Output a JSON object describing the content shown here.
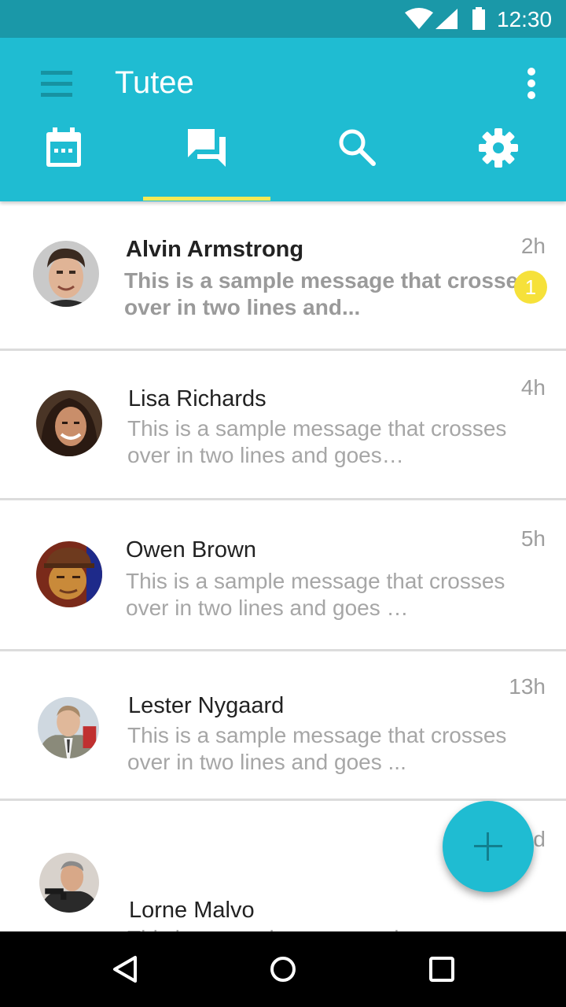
{
  "status_bar": {
    "time": "12:30",
    "icons": [
      "wifi-icon",
      "signal-icon",
      "battery-icon"
    ]
  },
  "app_bar": {
    "title": "Tutee",
    "background": "#1fbcd2",
    "indicator_color": "#f4ea55",
    "tabs": [
      {
        "icon": "calendar-icon",
        "selected": false
      },
      {
        "icon": "chat-icon",
        "selected": true
      },
      {
        "icon": "search-icon",
        "selected": false
      },
      {
        "icon": "settings-icon",
        "selected": false
      }
    ]
  },
  "conversations": [
    {
      "name": "Alvin Armstrong",
      "preview": "This is a sample message that crosses over in two lines and...",
      "time": "2h",
      "unread_count": "1",
      "avatar": "avatar-photo"
    },
    {
      "name": "Lisa Richards",
      "preview": "This is a sample message that crosses over in two lines and goes…",
      "time": "4h",
      "avatar": "avatar-photo"
    },
    {
      "name": "Owen Brown",
      "preview": "This is a sample message that crosses over in two lines and goes …",
      "time": "5h",
      "avatar": "avatar-photo"
    },
    {
      "name": "Lester Nygaard",
      "preview": "This is a sample message that crosses over in two lines and goes ...",
      "time": "13h",
      "avatar": "avatar-photo"
    },
    {
      "name": "Lorne Malvo",
      "preview": "This is a sample message that crosses over in two lines and goes on.",
      "time": "1d",
      "avatar": "avatar-photo"
    }
  ],
  "fab": {
    "icon": "plus-icon"
  },
  "nav_bar": {
    "icons": [
      "back-icon",
      "home-icon",
      "recents-icon"
    ]
  }
}
